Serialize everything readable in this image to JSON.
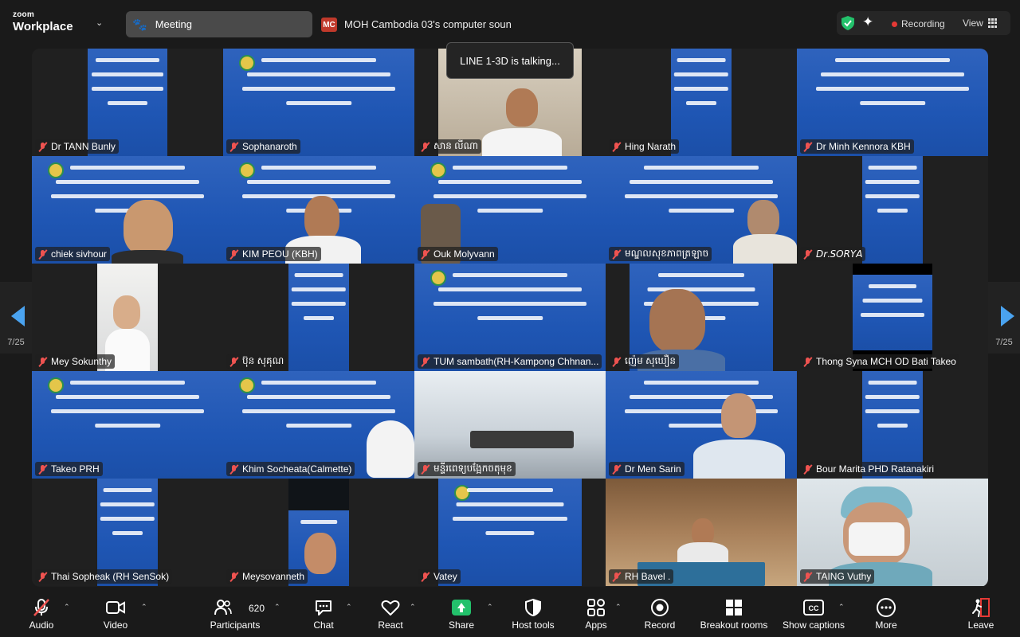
{
  "app": {
    "logo_small": "zoom",
    "logo_big": "Workplace"
  },
  "header": {
    "meeting_label": "Meeting",
    "share_initials": "MC",
    "share_text": "MOH Cambodia 03's computer soun",
    "recording_label": "Recording",
    "view_label": "View",
    "colors": {
      "recording_dot": "#e53935",
      "shield": "#23c16b",
      "share_chip": "#c0392b"
    }
  },
  "talking_indicator": "LINE 1-3D is talking...",
  "pager": {
    "left_page": "7/25",
    "right_page": "7/25"
  },
  "participants": [
    {
      "name": "Dr TANN Bunly",
      "muted": true
    },
    {
      "name": "Sophanaroth",
      "muted": true
    },
    {
      "name": "សាន លីណា",
      "muted": true
    },
    {
      "name": "Hing Narath",
      "muted": true
    },
    {
      "name": "Dr Minh Kennora KBH",
      "muted": true
    },
    {
      "name": "chiek sivhour",
      "muted": true
    },
    {
      "name": "KIM PEOU (KBH)",
      "muted": true
    },
    {
      "name": "Ouk Molyvann",
      "muted": true
    },
    {
      "name": "មណ្ឌលសុខភាពត្រឡាច",
      "muted": true
    },
    {
      "name": "𝘋𝘳.𝘚𝘖𝘙𝘠𝘈",
      "muted": true
    },
    {
      "name": "Mey Sokunthy",
      "muted": true
    },
    {
      "name": "ប៊ុន សុគុណ",
      "muted": true
    },
    {
      "name": "TUM sambath(RH-Kampong Chhnan...",
      "muted": true
    },
    {
      "name": "ញ៉េម សុឃឿន",
      "muted": true
    },
    {
      "name": "Thong Syna  MCH OD Bati Takeo",
      "muted": true
    },
    {
      "name": "Takeo PRH",
      "muted": true
    },
    {
      "name": "Khim Socheata(Calmette)",
      "muted": true
    },
    {
      "name": "មន្ទីរពេទ្យបង្អែកចតុមុខ",
      "muted": true
    },
    {
      "name": "Dr Men Sarin",
      "muted": true
    },
    {
      "name": "Bour Marita PHD Ratanakiri",
      "muted": true
    },
    {
      "name": "Thai Sopheak (RH SenSok)",
      "muted": true
    },
    {
      "name": "Meysovanneth",
      "muted": true
    },
    {
      "name": "Vatey",
      "muted": true
    },
    {
      "name": "RH Bavel .",
      "muted": true
    },
    {
      "name": "TAING Vuthy",
      "muted": true
    }
  ],
  "toolbar": {
    "audio": "Audio",
    "video": "Video",
    "participants": "Participants",
    "participants_count": "620",
    "chat": "Chat",
    "react": "React",
    "share": "Share",
    "host_tools": "Host tools",
    "apps": "Apps",
    "record": "Record",
    "breakout_rooms": "Breakout rooms",
    "show_captions": "Show captions",
    "more": "More",
    "leave": "Leave",
    "icons": [
      "mic-muted-icon",
      "camera-icon",
      "participants-icon",
      "chat-icon",
      "heart-icon",
      "share-screen-icon",
      "shield-icon",
      "apps-icon",
      "record-icon",
      "breakout-grid-icon",
      "captions-icon",
      "more-icon",
      "leave-icon"
    ],
    "colors": {
      "share": "#23c16b",
      "muted": "#ef5350",
      "leave": "#e53935"
    }
  }
}
